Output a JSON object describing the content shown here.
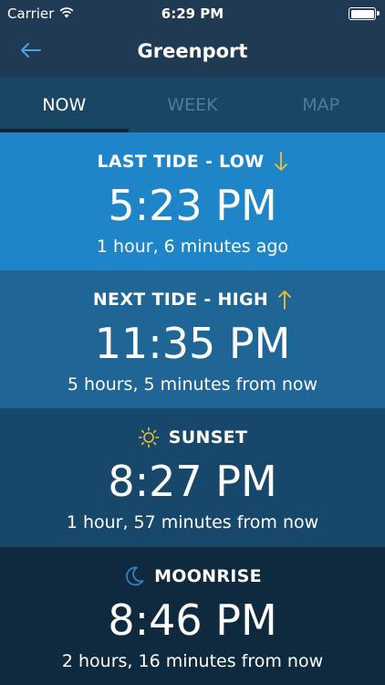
{
  "status_bar": {
    "carrier": "Carrier",
    "time": "6:29 PM",
    "icons": [
      "wifi-icon",
      "battery-icon"
    ]
  },
  "nav": {
    "title": "Greenport",
    "back_icon": "arrow-left-icon"
  },
  "tabs": [
    {
      "label": "NOW",
      "active": true
    },
    {
      "label": "WEEK",
      "active": false
    },
    {
      "label": "MAP",
      "active": false
    }
  ],
  "cards": [
    {
      "label": "LAST TIDE - LOW",
      "icon": "arrow-down-icon",
      "time": "5:23 PM",
      "sub": "1 hour, 6 minutes ago"
    },
    {
      "label": "NEXT TIDE - HIGH",
      "icon": "arrow-up-icon",
      "time": "11:35 PM",
      "sub": "5 hours, 5 minutes from now"
    },
    {
      "label": "SUNSET",
      "icon": "sun-icon",
      "time": "8:27 PM",
      "sub": "1 hour, 57 minutes from now"
    },
    {
      "label": "MOONRISE",
      "icon": "moon-icon",
      "time": "8:46 PM",
      "sub": "2 hours, 16 minutes from now"
    }
  ],
  "colors": {
    "accent": "#f0c030",
    "link": "#4fa3d9",
    "card_1": "#1e86c8",
    "card_2": "#1f6596",
    "card_3": "#17486c",
    "card_4": "#0f2a3f"
  }
}
